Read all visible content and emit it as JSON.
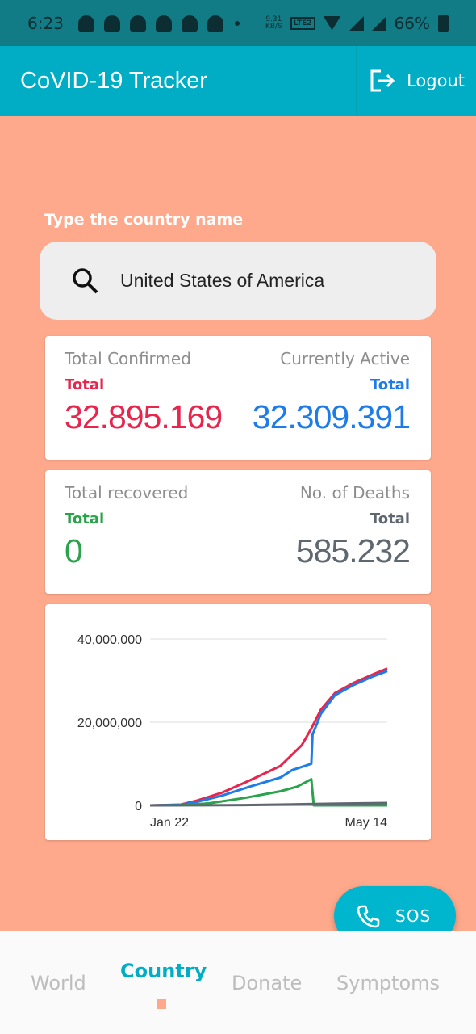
{
  "status_bar": {
    "time": "6:23",
    "net_speed_top": "9.31",
    "net_speed_bottom": "KB/S",
    "volte_label": "LTE2",
    "battery": "66%"
  },
  "app_bar": {
    "title": "CoVID-19 Tracker",
    "logout_label": "Logout"
  },
  "search": {
    "label": "Type the country name",
    "value": "United States of America"
  },
  "stats": {
    "confirmed": {
      "heading": "Total Confirmed",
      "sub": "Total",
      "value": "32.895.169",
      "color": "#E8254D"
    },
    "active": {
      "heading": "Currently Active",
      "sub": "Total",
      "value": "32.309.391",
      "color": "#1E7CE8"
    },
    "recovered": {
      "heading": "Total recovered",
      "sub": "Total",
      "value": "0",
      "color": "#2BA24C"
    },
    "deaths": {
      "heading": "No. of Deaths",
      "sub": "Total",
      "value": "585.232",
      "color": "#5F6770"
    }
  },
  "chart_data": {
    "type": "line",
    "x_tick_labels": [
      "Jan 22",
      "May 14"
    ],
    "y_tick_labels": [
      "0",
      "20,000,000",
      "40,000,000"
    ],
    "ylim": [
      0,
      40000000
    ],
    "grid": true,
    "series": [
      {
        "color": "#E8254D",
        "x": [
          0,
          0.13,
          0.2,
          0.3,
          0.42,
          0.55,
          0.64,
          0.68,
          0.72,
          0.78,
          0.86,
          0.94,
          1.0
        ],
        "y": [
          0,
          200000,
          1200000,
          3000000,
          6000000,
          9500000,
          14500000,
          18500000,
          23000000,
          27000000,
          29500000,
          31500000,
          32900000
        ]
      },
      {
        "color": "#1E7CE8",
        "x": [
          0,
          0.13,
          0.2,
          0.3,
          0.42,
          0.55,
          0.6,
          0.68,
          0.685,
          0.72,
          0.78,
          0.86,
          0.94,
          1.0
        ],
        "y": [
          0,
          150000,
          900000,
          2300000,
          4500000,
          6700000,
          8500000,
          10000000,
          17000000,
          22000000,
          26500000,
          29000000,
          31000000,
          32300000
        ]
      },
      {
        "color": "#2BA24C",
        "x": [
          0,
          0.13,
          0.25,
          0.4,
          0.55,
          0.62,
          0.68,
          0.69,
          1.0
        ],
        "y": [
          0,
          50000,
          500000,
          1800000,
          3400000,
          4500000,
          6300000,
          0,
          0
        ]
      },
      {
        "color": "#5F6770",
        "x": [
          0,
          0.2,
          0.4,
          0.6,
          0.8,
          1.0
        ],
        "y": [
          0,
          20000,
          80000,
          250000,
          420000,
          585000
        ]
      }
    ]
  },
  "sos_label": "SOS",
  "nav": {
    "world": "World",
    "country": "Country",
    "donate": "Donate",
    "symptoms": "Symptoms"
  }
}
